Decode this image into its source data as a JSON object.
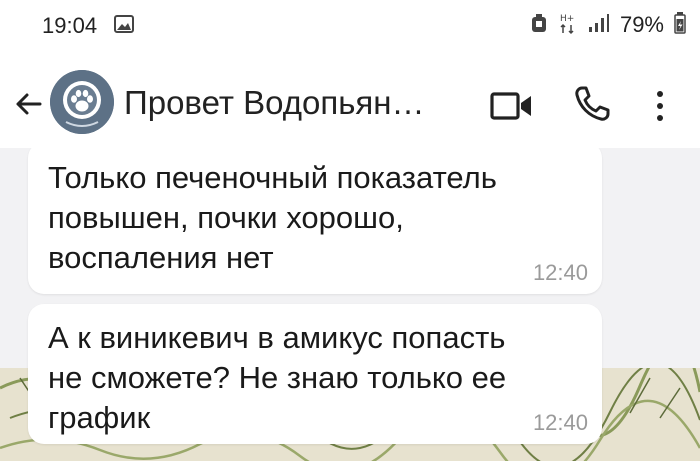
{
  "status_bar": {
    "time": "19:04",
    "battery_percent": "79%"
  },
  "header": {
    "contact_name": "Провет Водопьян…"
  },
  "messages": [
    {
      "text": "Только печеночный показатель повышен, почки хорошо, воспаления нет",
      "time": "12:40"
    },
    {
      "text": "А к виникевич в амикус попасть не сможете? Не знаю только ее график",
      "time": "12:40"
    }
  ]
}
